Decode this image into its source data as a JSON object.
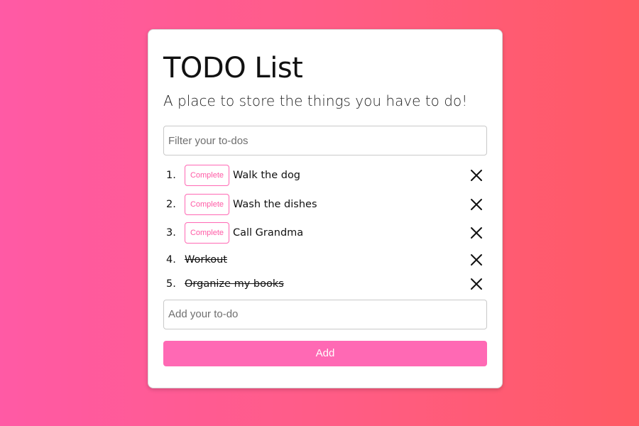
{
  "app": {
    "title": "TODO List",
    "subtitle": "A place to store the things you have to do!"
  },
  "filter": {
    "placeholder": "Filter your to-dos",
    "value": ""
  },
  "todos": [
    {
      "number": "1.",
      "text": "Walk the dog",
      "completed": false,
      "complete_label": "Complete"
    },
    {
      "number": "2.",
      "text": "Wash the dishes",
      "completed": false,
      "complete_label": "Complete"
    },
    {
      "number": "3.",
      "text": "Call Grandma",
      "completed": false,
      "complete_label": "Complete"
    },
    {
      "number": "4.",
      "text": "Workout",
      "completed": true
    },
    {
      "number": "5.",
      "text": "Organize my books",
      "completed": true
    }
  ],
  "add": {
    "placeholder": "Add your to-do",
    "value": "",
    "button_label": "Add"
  },
  "colors": {
    "accent": "#ff69b4",
    "background_start": "#ff5aa5",
    "background_end": "#ff5a63"
  },
  "icons": {
    "delete": "close-icon"
  }
}
